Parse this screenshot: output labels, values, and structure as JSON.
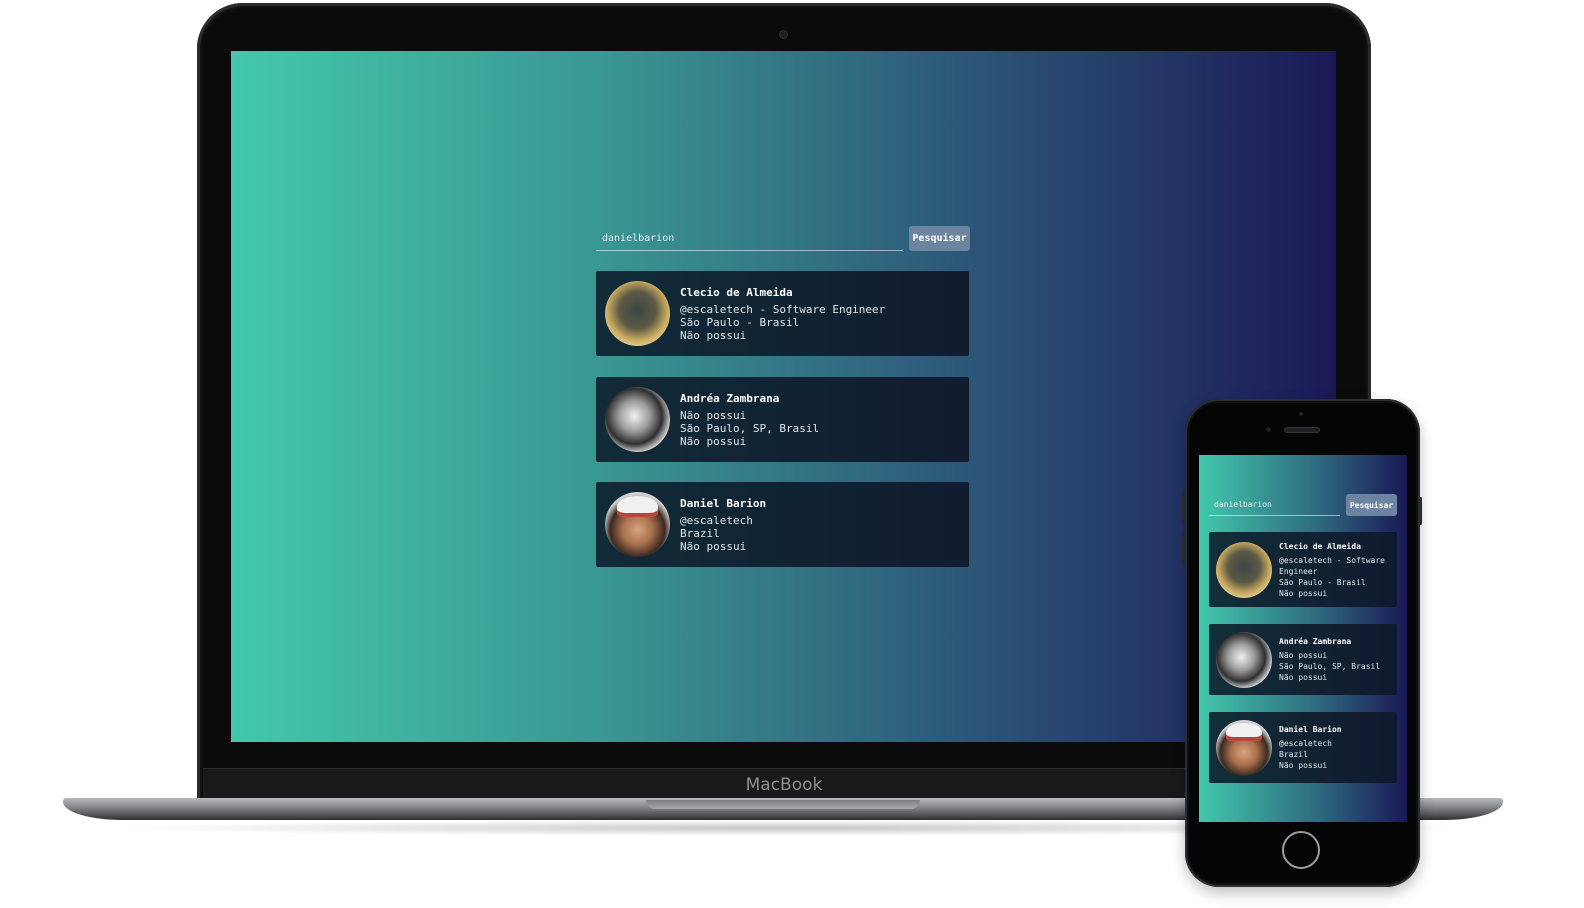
{
  "laptop": {
    "brand": "MacBook"
  },
  "search": {
    "value": "danielbarion",
    "button_label": "Pesquisar"
  },
  "users": [
    {
      "name": "Clecio de Almeida",
      "lines": [
        "@escaletech - Software Engineer",
        "São Paulo - Brasil",
        "Não possui"
      ]
    },
    {
      "name": "Andréa Zambrana",
      "lines": [
        "Não possui",
        "São Paulo, SP, Brasil",
        "Não possui"
      ]
    },
    {
      "name": "Daniel Barion",
      "lines": [
        "@escaletech",
        "Brazil",
        "Não possui"
      ]
    }
  ],
  "phone_users": [
    {
      "name": "Clecio de Almeida",
      "lines": [
        "@escaletech - Software",
        "Engineer",
        "São Paulo - Brasil",
        "Não possui"
      ]
    },
    {
      "name": "Andréa Zambrana",
      "lines": [
        "Não possui",
        "São Paulo, SP, Brasil",
        "Não possui"
      ]
    },
    {
      "name": "Daniel Barion",
      "lines": [
        "@escaletech",
        "Brazil",
        "Não possui"
      ]
    }
  ],
  "colors": {
    "gradient_start": "#43c8ac",
    "gradient_end": "#1b1856",
    "button": "#6d84a0",
    "card": "#122332"
  }
}
